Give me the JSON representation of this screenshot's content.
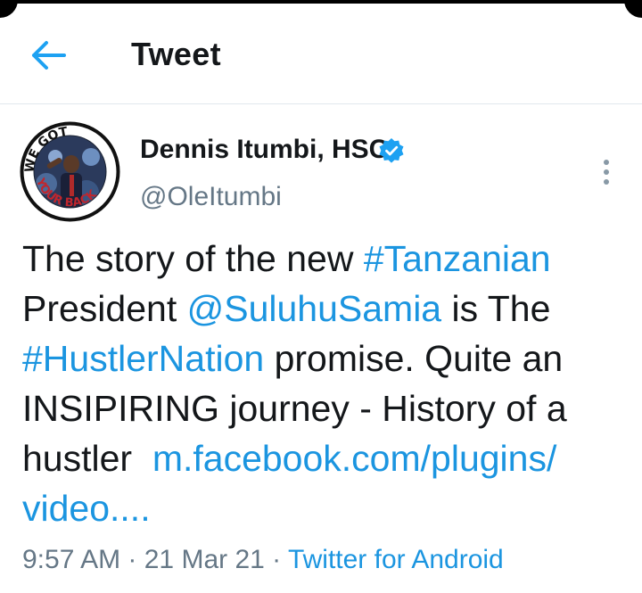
{
  "header": {
    "title": "Tweet",
    "back_icon": "arrow-left-icon",
    "accent": "#1da1f2"
  },
  "tweet": {
    "author_name": "Dennis Itumbi, HSC",
    "handle": "@OleItumbi",
    "verified_icon": "verified-badge-icon",
    "more_icon": "more-vertical-icon",
    "avatar_text_top": "WE GOT",
    "avatar_text_bottom": "YOUR BACK",
    "text": {
      "l1_a": "The story of the new ",
      "l1_tag": "#Tanzanian",
      "l2_a": "President ",
      "l2_mention": "@SuluhuSamia",
      "l2_b": " is The",
      "l3_tag": "#HustlerNation",
      "l3_b": " promise. Quite an",
      "l4": "INSIPIRING journey - History of a",
      "l5_a": "hustler  ",
      "l5_link": "m.facebook.com/plugins/",
      "l6_link": "video...."
    },
    "time": "9:57 AM",
    "sep1": " · ",
    "date": "21 Mar 21",
    "sep2": " · ",
    "source": "Twitter for Android"
  },
  "colors": {
    "link": "#1b95e0",
    "secondary_text": "#657786",
    "primary_text": "#14171a"
  }
}
